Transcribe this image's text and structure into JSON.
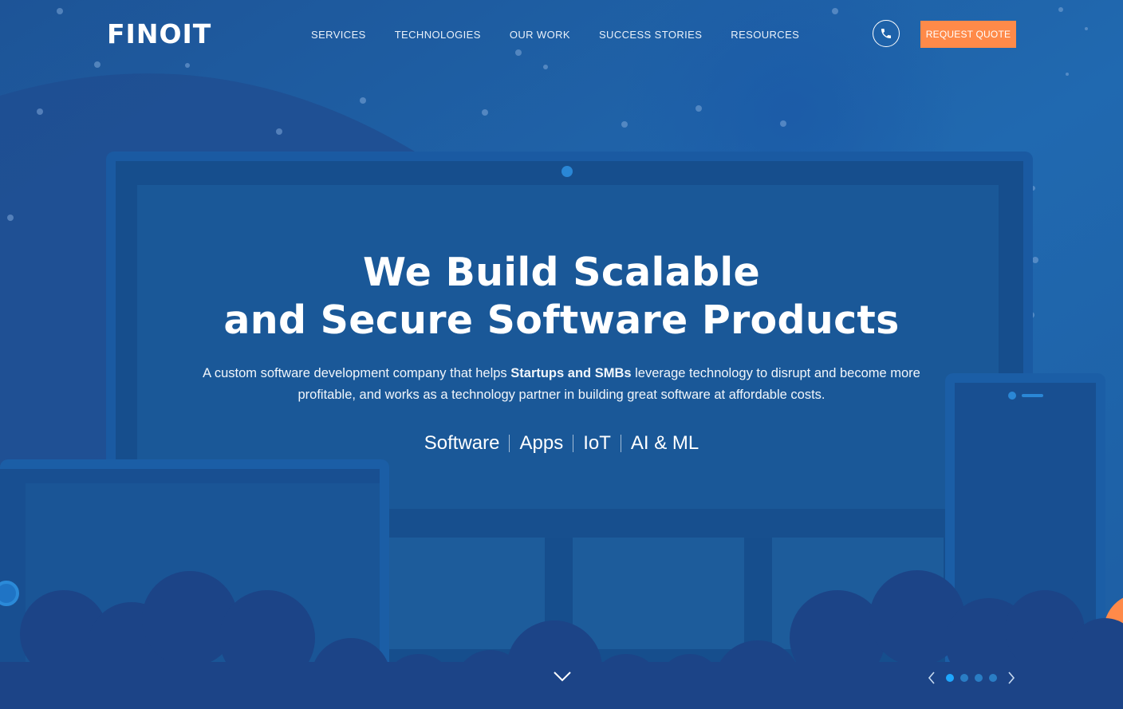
{
  "brand": {
    "logo_text": "FINOIT"
  },
  "nav": {
    "items": [
      {
        "label": "SERVICES"
      },
      {
        "label": "TECHNOLOGIES"
      },
      {
        "label": "OUR WORK"
      },
      {
        "label": "SUCCESS STORIES"
      },
      {
        "label": "RESOURCES"
      }
    ]
  },
  "header": {
    "phone_icon": "phone-icon",
    "quote_label": "REQUEST QUOTE"
  },
  "hero": {
    "title_line1": "We Build Scalable",
    "title_line2": "and Secure Software Products",
    "subtitle_before": "A custom software development company that helps ",
    "subtitle_bold": "Startups and SMBs",
    "subtitle_after": " leverage technology to disrupt and become more profitable, and works as a technology partner in building great software at affordable costs.",
    "tags": [
      "Software",
      "Apps",
      "IoT",
      "AI & ML"
    ]
  },
  "slider": {
    "slide_count": 4,
    "active_index": 0
  },
  "colors": {
    "background": "#1f62a6",
    "accent": "#ff8a49",
    "active_dot": "#1ea7ff",
    "inactive_dot": "#2a7dc4"
  }
}
